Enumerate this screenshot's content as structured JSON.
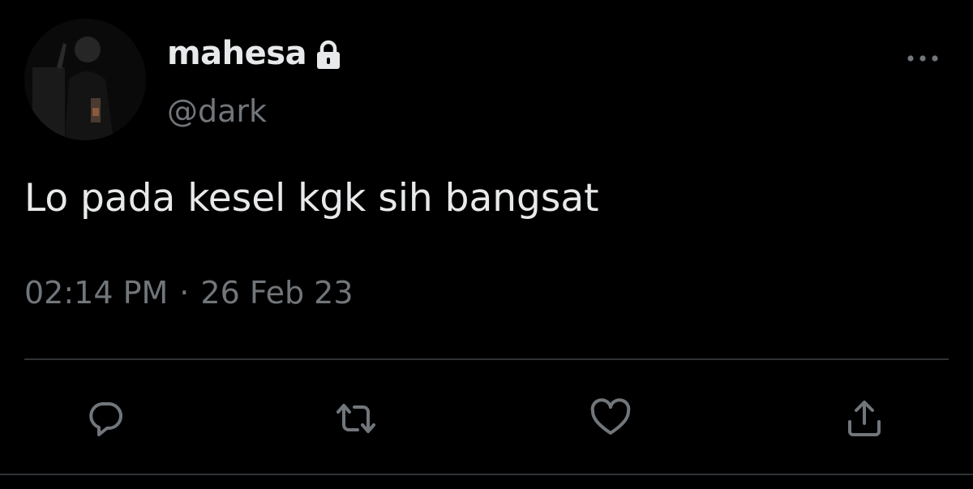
{
  "author": {
    "display_name": "mahesa",
    "handle": "@dark",
    "protected_icon": "lock-icon",
    "avatar": "profile-photo"
  },
  "tweet": {
    "text": "Lo pada kesel kgk sih bangsat",
    "time": "02:14 PM",
    "separator": "·",
    "date": "26 Feb 23"
  },
  "actions": [
    {
      "icon": "reply-icon"
    },
    {
      "icon": "retweet-icon"
    },
    {
      "icon": "like-icon"
    },
    {
      "icon": "share-icon"
    }
  ],
  "menu_icon": "more-options-icon",
  "colors": {
    "background": "#000000",
    "primary_text": "#e7e9ea",
    "secondary_text": "#71767b",
    "divider": "#2f3336"
  }
}
